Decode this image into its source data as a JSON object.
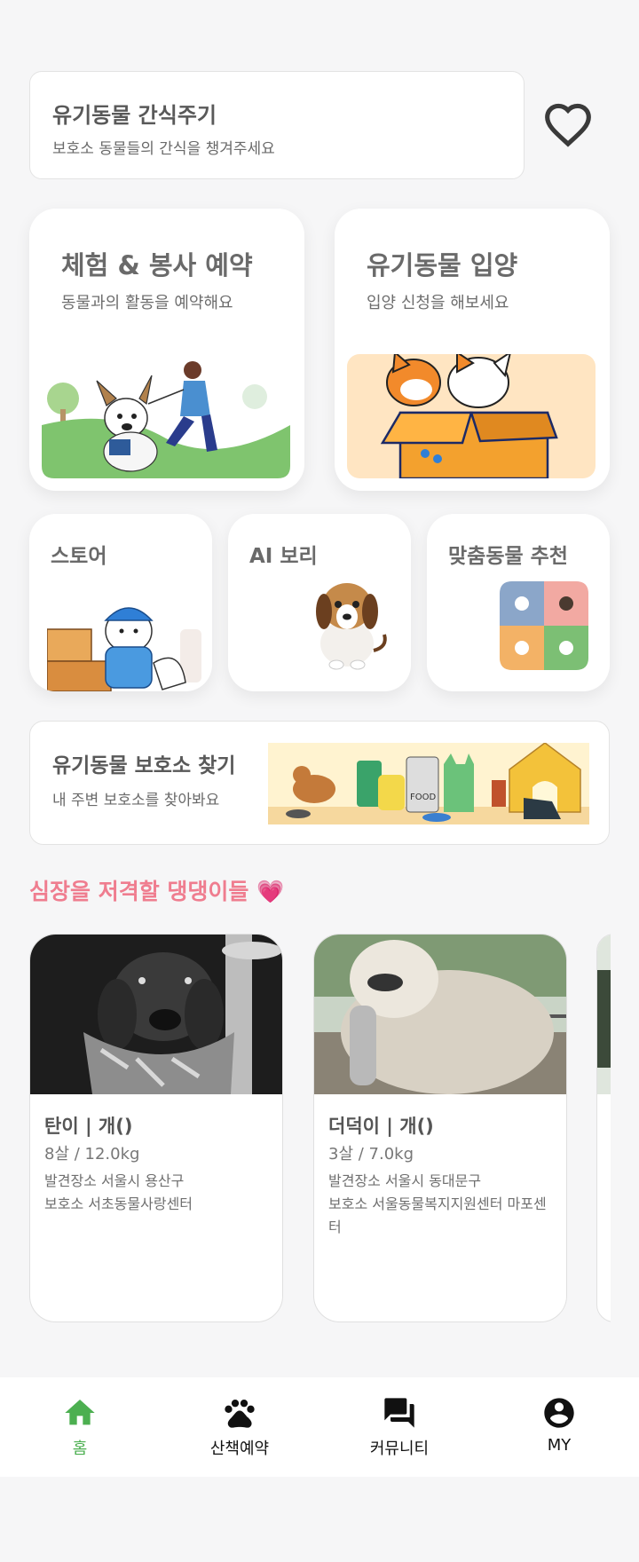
{
  "snack": {
    "title": "유기동물 간식주기",
    "subtitle": "보호소 동물들의 간식을 챙겨주세요"
  },
  "experience": {
    "title": "체험 & 봉사 예약",
    "subtitle": "동물과의 활동을 예약해요"
  },
  "adoption": {
    "title": "유기동물 입양",
    "subtitle": "입양 신청을 해보세요"
  },
  "tiles": {
    "store": "스토어",
    "ai": "AI 보리",
    "match": "맞춤동물 추천"
  },
  "shelter": {
    "title": "유기동물 보호소 찾기",
    "subtitle": "내 주변 보호소를 찾아봐요",
    "sign": "FOOD"
  },
  "section_title": "심장을 저격할 댕댕이들 💗",
  "pets": [
    {
      "name": "탄이 | 개()",
      "age": "8살 / 12.0kg",
      "location": "발견장소 서울시 용산구",
      "shelter": "보호소 서초동물사랑센터"
    },
    {
      "name": "더덕이 | 개()",
      "age": "3살 / 7.0kg",
      "location": "발견장소 서울시 동대문구",
      "shelter": "보호소 서울동물복지지원센터 마포센터"
    }
  ],
  "nav": {
    "home": "홈",
    "walk": "산책예약",
    "community": "커뮤니티",
    "my": "MY"
  },
  "colors": {
    "accent": "#4caf50",
    "pink": "#ef7d8f"
  },
  "icons": [
    "heart-outline-icon",
    "home-icon",
    "paw-icon",
    "chat-icon",
    "account-circle-icon"
  ]
}
